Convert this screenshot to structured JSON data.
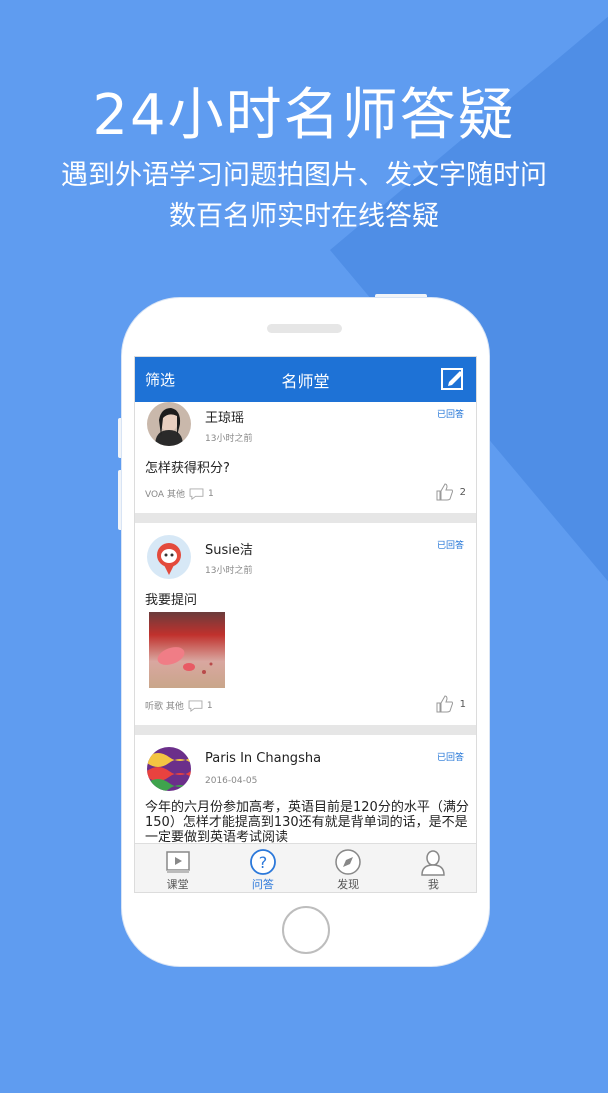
{
  "promo": {
    "headline": "24小时名师答疑",
    "subtitle_line1": "遇到外语学习问题拍图片、发文字随时问",
    "subtitle_line2": "数百名师实时在线答疑"
  },
  "topbar": {
    "filter_label": "筛选",
    "title": "名师堂",
    "edit_icon": "edit-icon"
  },
  "posts": [
    {
      "username": "王琼瑶",
      "time": "13小时之前",
      "status": "已回答",
      "question": "怎样获得积分?",
      "category": "VOA 其他",
      "comments": "1",
      "likes": "2"
    },
    {
      "username": "Susie洁",
      "time": "13小时之前",
      "status": "已回答",
      "question": "我要提问",
      "category": "听歌 其他",
      "comments": "1",
      "likes": "1"
    },
    {
      "username": "Paris In Changsha",
      "time": "2016-04-05",
      "status": "已回答",
      "question": "今年的六月份参加高考，英语目前是120分的水平（满分150）怎样才能提高到130还有就是背单词的话，是不是一定要做到英语考试阅读"
    }
  ],
  "tabs": [
    {
      "label": "课堂",
      "icon": "play-icon"
    },
    {
      "label": "问答",
      "icon": "question-icon"
    },
    {
      "label": "发现",
      "icon": "compass-icon"
    },
    {
      "label": "我",
      "icon": "user-icon"
    }
  ],
  "colors": {
    "background": "#5f9cf0",
    "accent": "#1e72d6"
  }
}
